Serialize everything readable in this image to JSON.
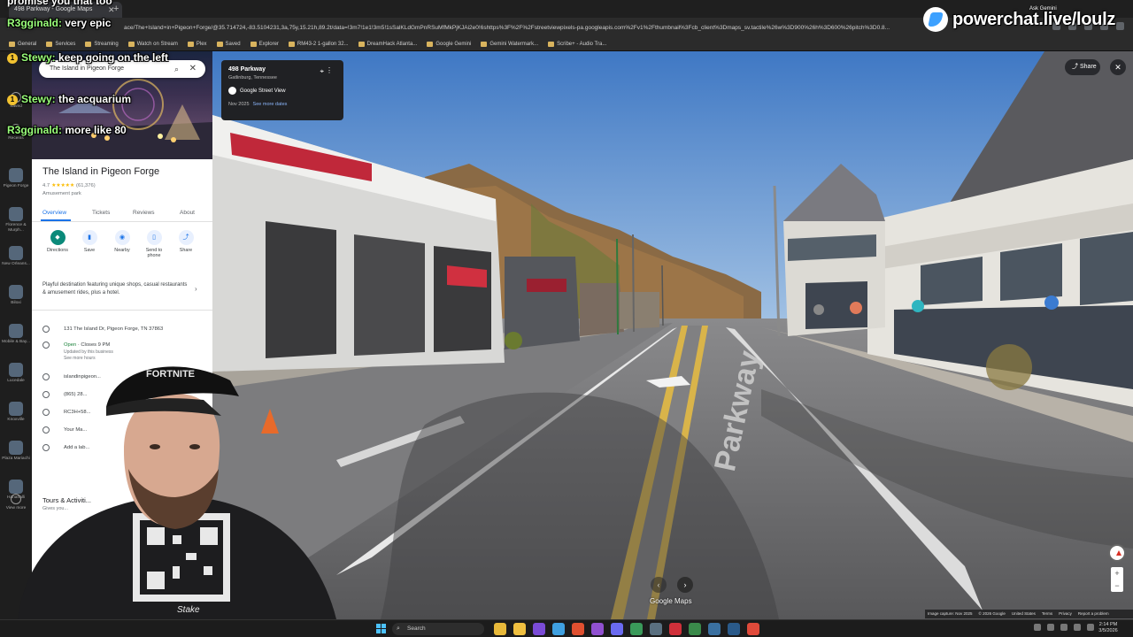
{
  "browser": {
    "tab_title": "498 Parkway - Google Maps",
    "url": "ace/The+Island+in+Pigeon+Forge/@35.714724,-83.5104231,3a,75y,15.21h,89.2t/data=!3m7!1e1!3m5!1sSalKLdGmPnRSuMfMkPjKJAi2e0!6shttps%3F%2F%2Fstreetviewpixels-pa.googleapis.com%2Fv1%2Fthumbnail%3Fcb_client%3Dmaps_sv.tactile%26w%3D900%26h%3D600%26pitch%3D0.8...",
    "bookmarks": [
      "General",
      "Services",
      "Streaming",
      "Watch on Stream",
      "Plex",
      "Saved",
      "Explorer",
      "RM43-2 1-gallon 32...",
      "DreamHack Atlanta...",
      "Google Gemini",
      "Gemini Watermark...",
      "Scribe+ - Audio Tra..."
    ],
    "ask_gemini": "Ask Gemini"
  },
  "rail": {
    "saved": "Saved",
    "recents": "Recents",
    "items": [
      "Pigeon Forge",
      "Florence & Murph...",
      "New Orleans...",
      "Biloxi",
      "Mobile & Bay...",
      "Lucedale",
      "Knoxville",
      "Plaza Mariachi",
      "Hanahalli"
    ],
    "view_more": "View more"
  },
  "panel": {
    "search_value": "The Island in Pigeon Forge",
    "title": "The Island in Pigeon Forge",
    "rating": "4.7",
    "reviews_count": "(61,376)",
    "category": "Amusement park",
    "tabs": [
      "Overview",
      "Tickets",
      "Reviews",
      "About"
    ],
    "actions": [
      "Directions",
      "Save",
      "Nearby",
      "Send to phone",
      "Share"
    ],
    "about": "Playful destination featuring unique shops, casual restaurants & amusement rides, plus a hotel.",
    "address": "131 The Island Dr, Pigeon Forge, TN 37863",
    "hours_open": "Open",
    "hours_close": "· Closes 9 PM",
    "hours_note": "Updated by this business",
    "hours_more": "See more hours",
    "website": "islandinpigeon...",
    "phone": "(865) 28...",
    "plus_code": "RC3H+58...",
    "your_maps": "Your Ma...",
    "add_label": "Add a lab...",
    "tours_title": "Tours & Activiti...",
    "tours_sub": "Gives you..."
  },
  "streetview": {
    "location_title": "498 Parkway",
    "location_sub": "Gatlinburg, Tennessee",
    "source": "Google Street View",
    "date": "Nov 2025",
    "see_more": "See more dates",
    "share": "Share",
    "road_label": "Parkway",
    "logo": "Google Maps",
    "footer": [
      "Image capture: Nov 2025",
      "© 2026 Google",
      "United States",
      "Terms",
      "Privacy",
      "Report a problem"
    ],
    "store_sign": "SCHERZ"
  },
  "taskbar": {
    "search": "Search",
    "time": "2:14 PM",
    "date": "3/5/2026"
  },
  "overlay": {
    "top_text": "promise you that too",
    "chat": [
      {
        "user": "R3gginald:",
        "msg": "very epic",
        "badge": false
      },
      {
        "user": "Stewy:",
        "msg": "keep going on the left",
        "badge": true
      },
      {
        "user": "Stewy:",
        "msg": "the acquarium",
        "badge": true
      },
      {
        "user": "R3gginald:",
        "msg": "more like 80",
        "badge": false
      }
    ],
    "brand": "powerchat.live/loulz",
    "cap_text": "FORTNITE",
    "shirt_text": "Stake"
  },
  "colors": {
    "sky": "#4f86c9",
    "road": "#6e6e70",
    "accent": "#1a73e8",
    "directions": "#0b8a7a",
    "chat_user": "#9aff7a"
  }
}
